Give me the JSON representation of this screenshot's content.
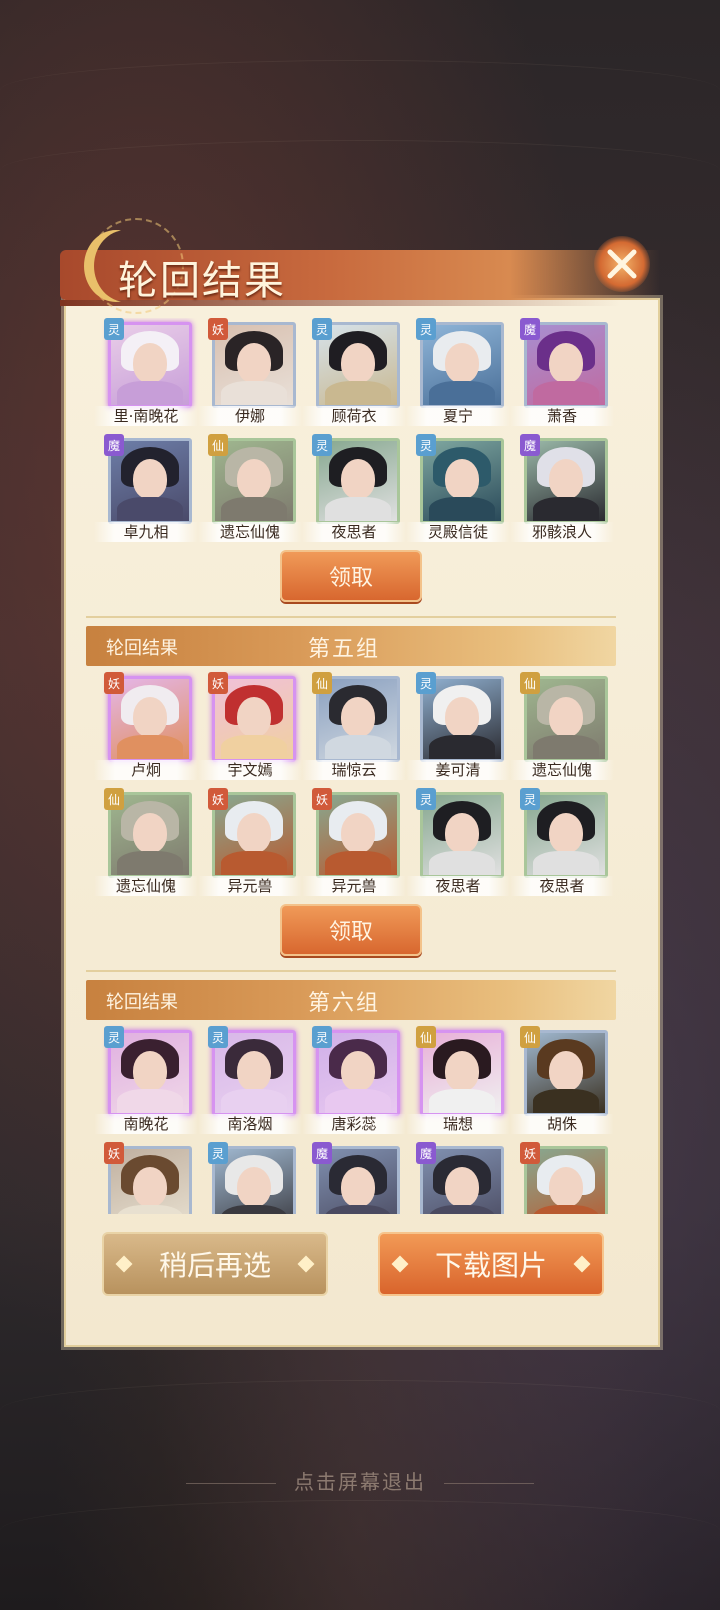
{
  "title": "轮回结果",
  "groups": [
    {
      "label": "",
      "number": "",
      "claim": "领取",
      "members": [
        {
          "name": "里·南晚花",
          "badge": "灵",
          "badge_class": "ling",
          "frame": "purple",
          "tone": [
            "#e9cde8",
            "#f4f0f6",
            "#c79ed8"
          ]
        },
        {
          "name": "伊娜",
          "badge": "妖",
          "badge_class": "yao",
          "frame": "blue",
          "tone": [
            "#d8c0b0",
            "#2a2426",
            "#e9e0d8"
          ]
        },
        {
          "name": "顾荷衣",
          "badge": "灵",
          "badge_class": "ling",
          "frame": "blue",
          "tone": [
            "#d6e2ea",
            "#1f1d22",
            "#c9b890"
          ]
        },
        {
          "name": "夏宁",
          "badge": "灵",
          "badge_class": "ling",
          "frame": "blue",
          "tone": [
            "#8fb5d8",
            "#e9ecef",
            "#4a6f98"
          ]
        },
        {
          "name": "萧香",
          "badge": "魔",
          "badge_class": "mo",
          "frame": "blue",
          "tone": [
            "#a88fd0",
            "#6b2f8a",
            "#c06aa0"
          ]
        },
        {
          "name": "卓九相",
          "badge": "魔",
          "badge_class": "mo",
          "frame": "blue",
          "tone": [
            "#6d7ea8",
            "#22222e",
            "#4a4a6a"
          ]
        },
        {
          "name": "遗忘仙傀",
          "badge": "仙",
          "badge_class": "xian",
          "frame": "green",
          "tone": [
            "#9fb68f",
            "#b9b6a6",
            "#7e7a6e"
          ]
        },
        {
          "name": "夜思者",
          "badge": "灵",
          "badge_class": "ling",
          "frame": "green",
          "tone": [
            "#87a890",
            "#1e1e22",
            "#e0e0e0"
          ]
        },
        {
          "name": "灵殿信徒",
          "badge": "灵",
          "badge_class": "ling",
          "frame": "green",
          "tone": [
            "#7fa7a0",
            "#2d5a6a",
            "#2a4a5a"
          ]
        },
        {
          "name": "邪骸浪人",
          "badge": "魔",
          "badge_class": "mo",
          "frame": "green",
          "tone": [
            "#9ab8a8",
            "#e0e0e8",
            "#2a2a30"
          ]
        }
      ]
    },
    {
      "label": "轮回结果",
      "number": "第五组",
      "claim": "领取",
      "members": [
        {
          "name": "卢炯",
          "badge": "妖",
          "badge_class": "yao",
          "frame": "purple",
          "tone": [
            "#e4b6e8",
            "#f0ecf0",
            "#e09060"
          ]
        },
        {
          "name": "宇文嫣",
          "badge": "妖",
          "badge_class": "yao",
          "frame": "purple",
          "tone": [
            "#f0c0d8",
            "#c03030",
            "#f0d0a0"
          ]
        },
        {
          "name": "瑞惊云",
          "badge": "仙",
          "badge_class": "xian",
          "frame": "blue",
          "tone": [
            "#8aa0c0",
            "#2a2a30",
            "#d0d8e0"
          ]
        },
        {
          "name": "姜可清",
          "badge": "灵",
          "badge_class": "ling",
          "frame": "blue",
          "tone": [
            "#90b0d0",
            "#f0f0f0",
            "#2a2a30"
          ]
        },
        {
          "name": "遗忘仙傀",
          "badge": "仙",
          "badge_class": "xian",
          "frame": "green",
          "tone": [
            "#9fb68f",
            "#b9b6a6",
            "#7e7a6e"
          ]
        },
        {
          "name": "遗忘仙傀",
          "badge": "仙",
          "badge_class": "xian",
          "frame": "green",
          "tone": [
            "#9fb68f",
            "#b9b6a6",
            "#7e7a6e"
          ]
        },
        {
          "name": "异元兽",
          "badge": "妖",
          "badge_class": "yao",
          "frame": "green",
          "tone": [
            "#88a890",
            "#e8ecf0",
            "#b85a30"
          ]
        },
        {
          "name": "异元兽",
          "badge": "妖",
          "badge_class": "yao",
          "frame": "green",
          "tone": [
            "#88a890",
            "#e8ecf0",
            "#b85a30"
          ]
        },
        {
          "name": "夜思者",
          "badge": "灵",
          "badge_class": "ling",
          "frame": "green",
          "tone": [
            "#87a890",
            "#1e1e22",
            "#e0e0e0"
          ]
        },
        {
          "name": "夜思者",
          "badge": "灵",
          "badge_class": "ling",
          "frame": "green",
          "tone": [
            "#87a890",
            "#1e1e22",
            "#e0e0e0"
          ]
        }
      ]
    },
    {
      "label": "轮回结果",
      "number": "第六组",
      "claim": "",
      "members": [
        {
          "name": "南晚花",
          "badge": "灵",
          "badge_class": "ling",
          "frame": "purple",
          "tone": [
            "#e0b0e0",
            "#3a2030",
            "#f0d8e8"
          ]
        },
        {
          "name": "南洛烟",
          "badge": "灵",
          "badge_class": "ling",
          "frame": "purple",
          "tone": [
            "#d8b8e8",
            "#3a2a3a",
            "#e8d0f0"
          ]
        },
        {
          "name": "唐彩蕊",
          "badge": "灵",
          "badge_class": "ling",
          "frame": "purple",
          "tone": [
            "#d0b0e8",
            "#4a2a4a",
            "#e8c8f0"
          ]
        },
        {
          "name": "瑞想",
          "badge": "仙",
          "badge_class": "xian",
          "frame": "purple",
          "tone": [
            "#e8b0d8",
            "#2a1a20",
            "#f0f0f0"
          ]
        },
        {
          "name": "胡侏",
          "badge": "仙",
          "badge_class": "xian",
          "frame": "blue",
          "tone": [
            "#a0b8d0",
            "#5a3a20",
            "#3a3020"
          ]
        },
        {
          "name": "",
          "badge": "妖",
          "badge_class": "yao",
          "frame": "blue",
          "tone": [
            "#c0b0a0",
            "#6a4a30",
            "#e8e0d0"
          ]
        },
        {
          "name": "",
          "badge": "灵",
          "badge_class": "ling",
          "frame": "blue",
          "tone": [
            "#a0b8d0",
            "#e8e8e8",
            "#3a3a40"
          ]
        },
        {
          "name": "",
          "badge": "魔",
          "badge_class": "mo",
          "frame": "blue",
          "tone": [
            "#8090b0",
            "#2a2a34",
            "#4a4a60"
          ]
        },
        {
          "name": "",
          "badge": "魔",
          "badge_class": "mo",
          "frame": "blue",
          "tone": [
            "#8090b0",
            "#2a2a34",
            "#4a4a60"
          ]
        },
        {
          "name": "",
          "badge": "妖",
          "badge_class": "yao",
          "frame": "green",
          "tone": [
            "#88a890",
            "#e8ecf0",
            "#b85a30"
          ]
        }
      ]
    }
  ],
  "buttons": {
    "later": "稍后再选",
    "download": "下载图片"
  },
  "exit_hint": "点击屏幕退出"
}
